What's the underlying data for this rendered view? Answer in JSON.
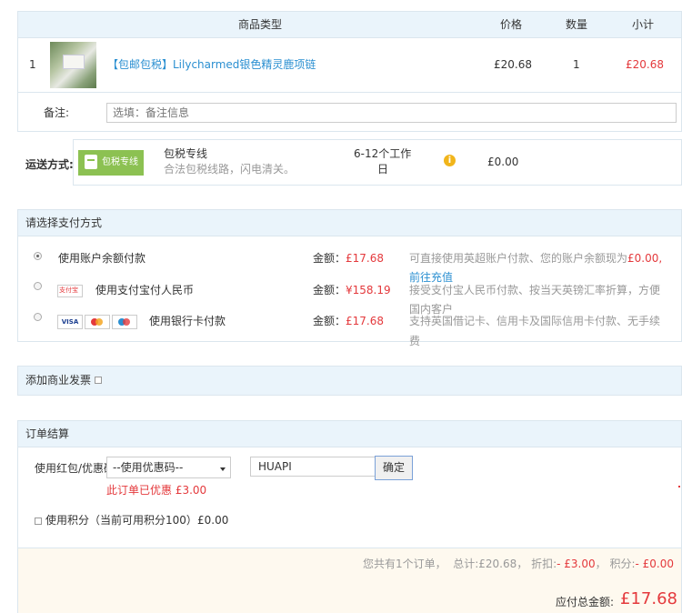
{
  "cart_table": {
    "headers": {
      "product_type": "商品类型",
      "price": "价格",
      "quantity": "数量",
      "subtotal": "小计"
    },
    "row": {
      "index": "1",
      "name": "【包邮包税】Lilycharmed银色精灵鹿项链",
      "price": "£20.68",
      "quantity": "1",
      "subtotal": "£20.68"
    },
    "note_label": "备注:",
    "note_placeholder": "选填：备注信息"
  },
  "shipping": {
    "label": "运送方式:",
    "badge_label": "包税专线",
    "name": "包税专线",
    "desc": "合法包税线路，闪电清关。",
    "time_line1": "6-12个工作",
    "time_line2": "日",
    "info_icon": "info-icon",
    "fee": "£0.00"
  },
  "payment": {
    "title": "请选择支付方式",
    "amount_label": "金额：",
    "options": [
      {
        "label": "使用账户余额付款",
        "amount": "£17.68",
        "desc_line1": "可直接使用英超账户付款、您的账户余额现为",
        "desc_highlight": "£0.00,",
        "link": "前往充值",
        "selected": true
      },
      {
        "label": "使用支付宝付人民币",
        "logo": "支付宝",
        "amount": "¥158.19",
        "desc_line1": "接受支付宝人民币付款、按当天英镑汇率折算，方便",
        "desc_line2": "国内客户",
        "selected": false
      },
      {
        "label": "使用银行卡付款",
        "card_logos": [
          "VISA",
          "MC",
          "MAESTRO"
        ],
        "amount": "£17.68",
        "desc_line1": "支持英国借记卡、信用卡及国际信用卡付款、无手续",
        "desc_line2": "费",
        "selected": false
      }
    ]
  },
  "invoice": {
    "label": "添加商业发票"
  },
  "checkout": {
    "title": "订单结算",
    "coupon_label": "使用红包/优惠码",
    "coupon_select": "--使用优惠码--",
    "coupon_code": "HUAPI",
    "confirm_button": "确定",
    "discount_note": "此订单已优惠 £3.00",
    "points_label": "使用积分（当前可用积分100）",
    "points_value": "£0.00",
    "summary_prefix": "您共有1个订单，",
    "total_label": "总计:",
    "total_value": "£20.68",
    "discount_label": "，  折扣:",
    "discount_value": "- £3.00",
    "points_sep": "，  积分:",
    "points_deduct": "- £0.00",
    "payable_label": "应付总金额:",
    "payable_value": "£17.68"
  }
}
